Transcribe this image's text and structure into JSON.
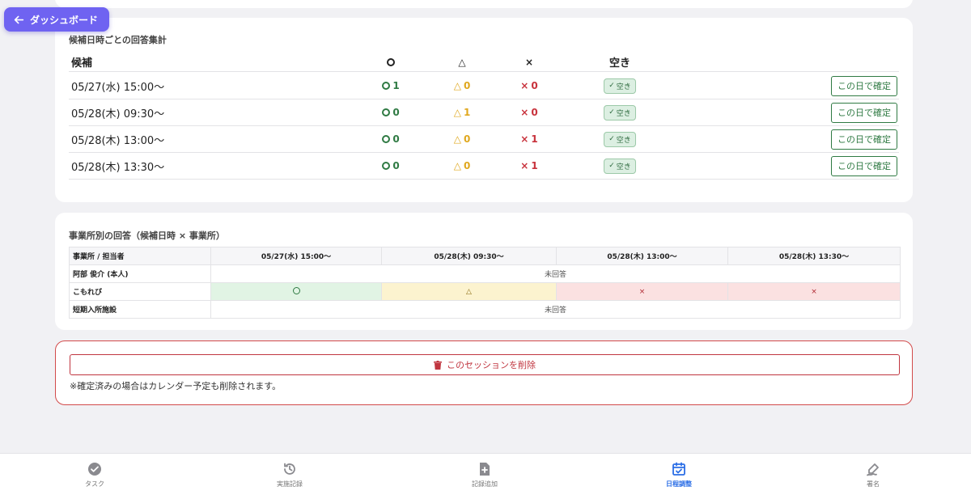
{
  "back_button": {
    "label": "ダッシュボード",
    "icon": "arrow-left-icon"
  },
  "summary": {
    "title": "候補日時ごとの回答集計",
    "headers": {
      "candidate": "候補",
      "ok": "○",
      "maybe": "△",
      "ng": "×",
      "free": "空き"
    },
    "rows": [
      {
        "date": "05/27(水) 15:00〜",
        "ok": "1",
        "maybe": "0",
        "ng": "0",
        "free": "空き",
        "action": "この日で確定"
      },
      {
        "date": "05/28(木) 09:30〜",
        "ok": "0",
        "maybe": "1",
        "ng": "0",
        "free": "空き",
        "action": "この日で確定"
      },
      {
        "date": "05/28(木) 13:00〜",
        "ok": "0",
        "maybe": "0",
        "ng": "1",
        "free": "空き",
        "action": "この日で確定"
      },
      {
        "date": "05/28(木) 13:30〜",
        "ok": "0",
        "maybe": "0",
        "ng": "1",
        "free": "空き",
        "action": "この日で確定"
      }
    ]
  },
  "matrix": {
    "title": "事業所別の回答（候補日時 × 事業所）",
    "corner": "事業所 / 担当者",
    "columns": [
      "05/27(水) 15:00〜",
      "05/28(木) 09:30〜",
      "05/28(木) 13:00〜",
      "05/28(木) 13:30〜"
    ],
    "rows": [
      {
        "name": "阿部 俊介 (本人)",
        "merged": "未回答"
      },
      {
        "name": "こもれび",
        "cells": [
          "○",
          "△",
          "×",
          "×"
        ]
      },
      {
        "name": "短期入所施設",
        "merged": "未回答"
      }
    ]
  },
  "danger": {
    "delete_label": "このセッションを削除",
    "note": "※確定済みの場合はカレンダー予定も削除されます。"
  },
  "nav": [
    {
      "label": "タスク",
      "icon": "check-circle-icon",
      "active": false
    },
    {
      "label": "実施記録",
      "icon": "history-icon",
      "active": false
    },
    {
      "label": "記録追加",
      "icon": "file-plus-icon",
      "active": false
    },
    {
      "label": "日程調整",
      "icon": "calendar-check-icon",
      "active": true
    },
    {
      "label": "署名",
      "icon": "signature-icon",
      "active": false
    }
  ],
  "colors": {
    "accent": "#6f63f1",
    "active_nav": "#2b6ee6",
    "ok": "#2f7a43",
    "maybe": "#e0a81f",
    "ng": "#c8323c",
    "danger": "#c0353f"
  }
}
